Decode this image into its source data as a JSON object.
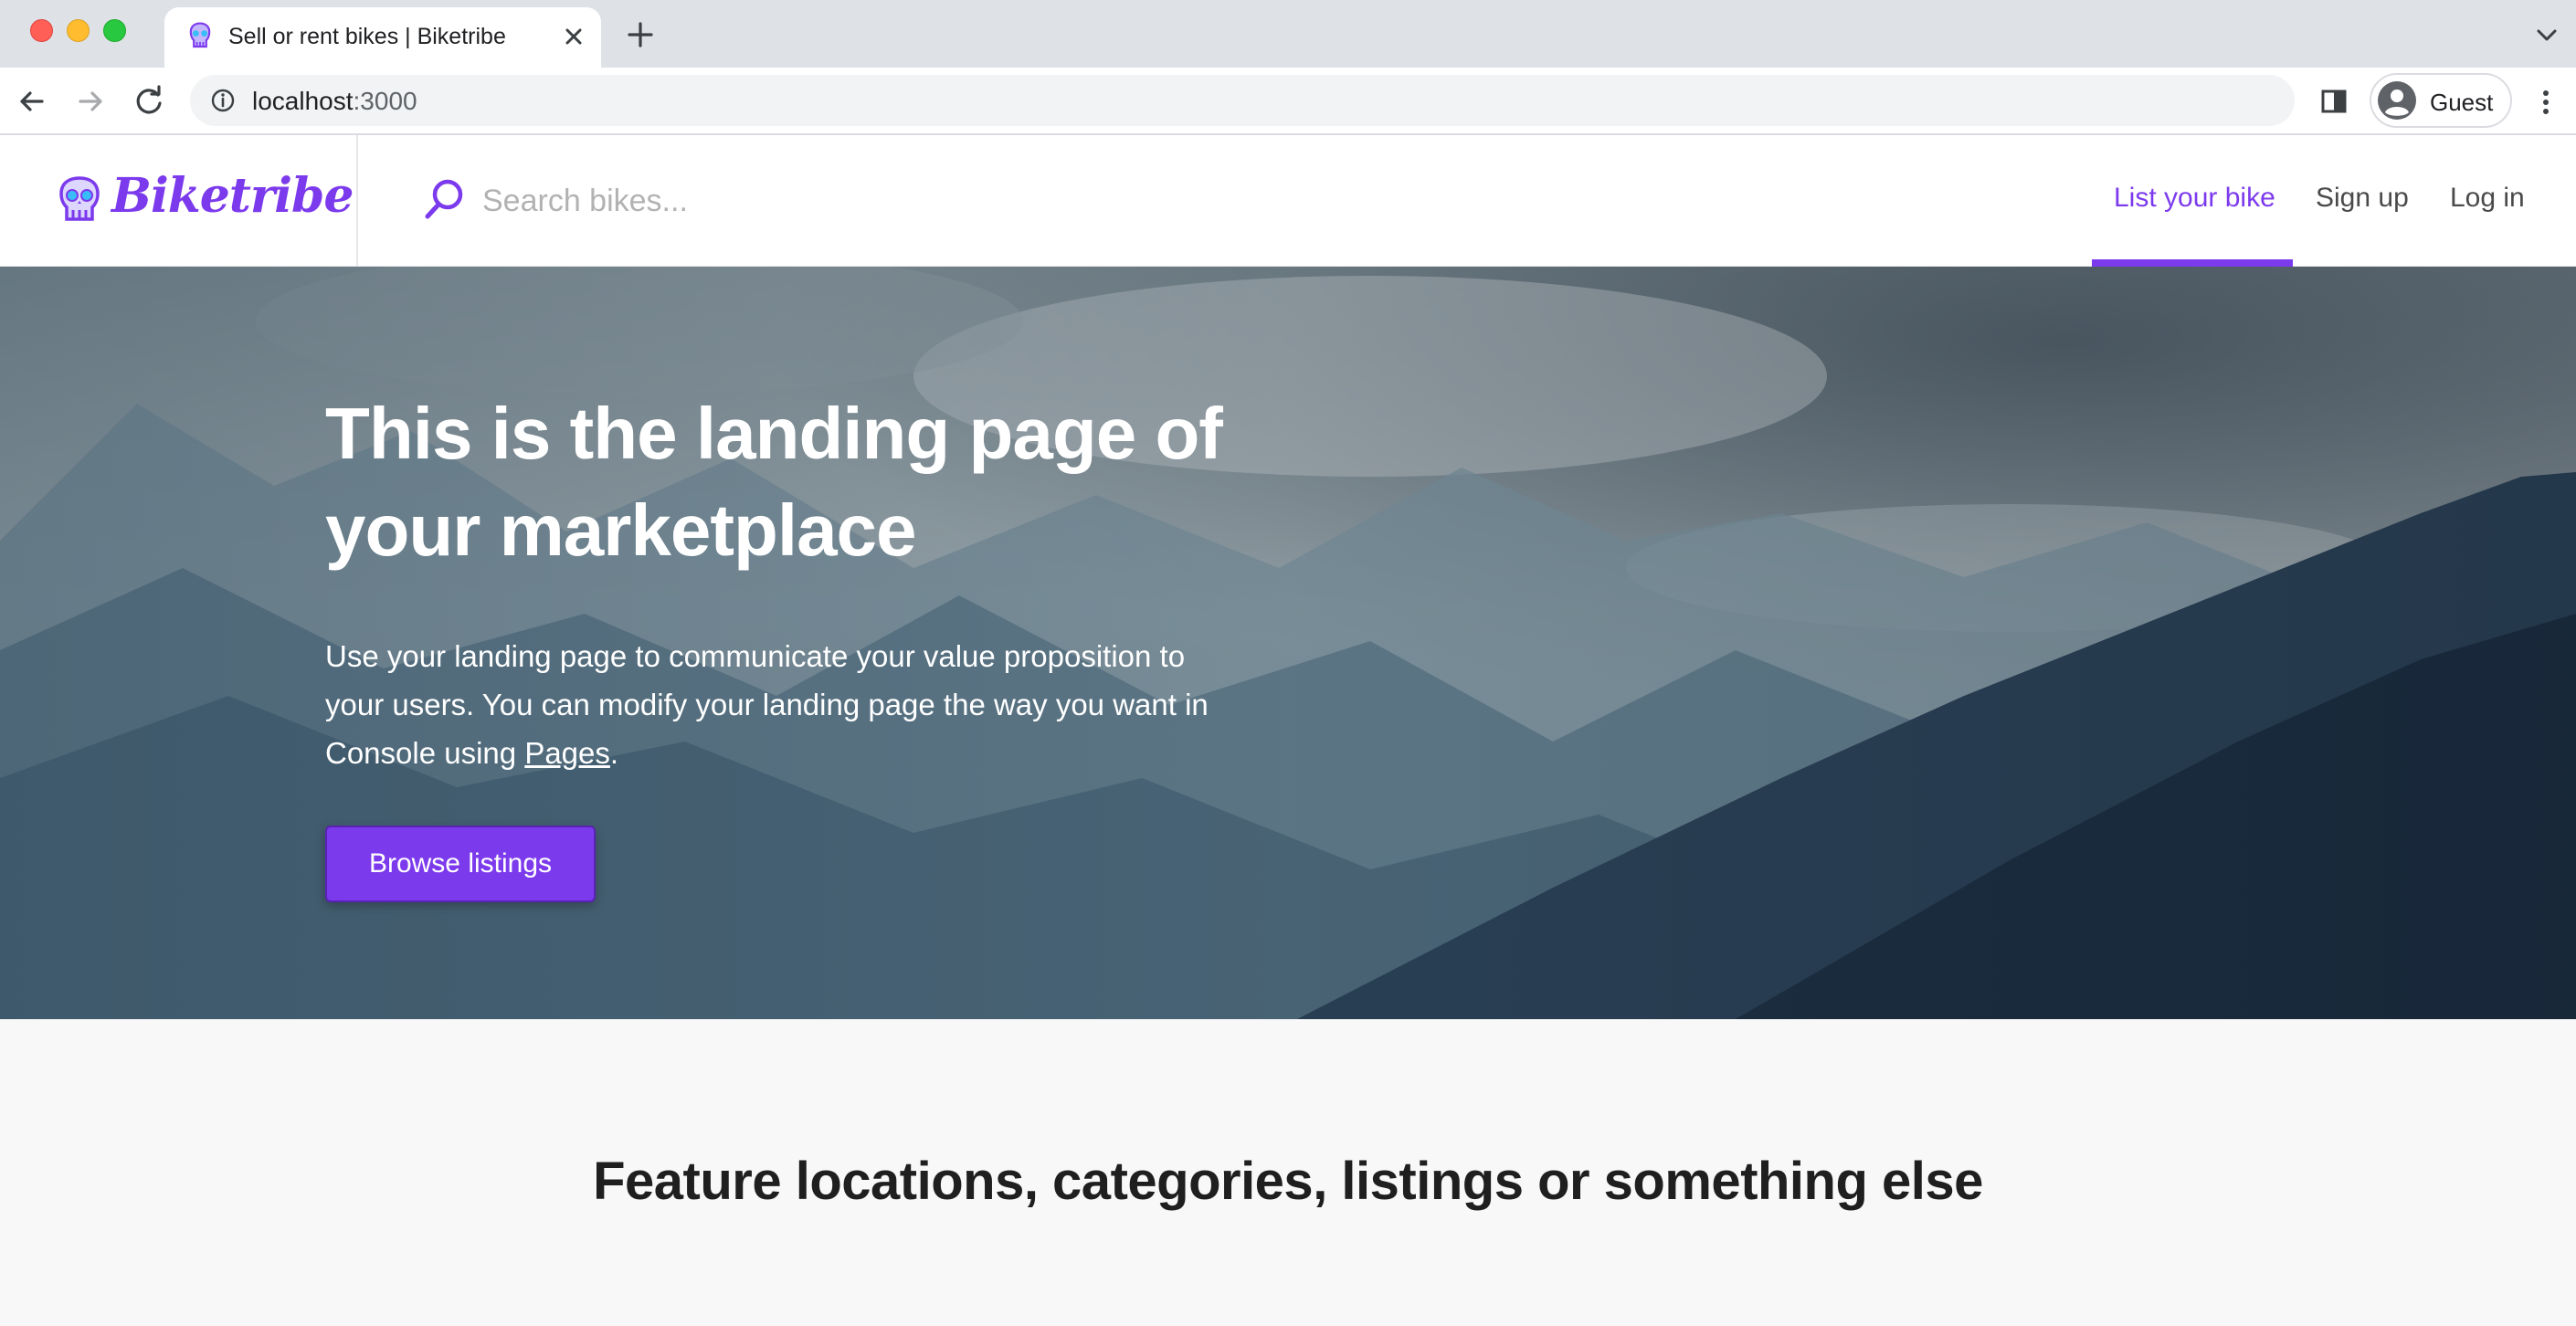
{
  "browser": {
    "tab_title": "Sell or rent bikes | Biketribe",
    "url_host": "localhost",
    "url_port": ":3000",
    "profile_name": "Guest"
  },
  "header": {
    "logo_text": "Biketribe",
    "search_placeholder": "Search bikes...",
    "nav": {
      "list_bike": "List your bike",
      "sign_up": "Sign up",
      "log_in": "Log in"
    }
  },
  "hero": {
    "title": "This is the landing page of your marketplace",
    "subtitle_before": "Use your landing page to communicate your value proposition to your users. You can modify your landing page the way you want in Console using ",
    "subtitle_link": "Pages",
    "subtitle_after": ".",
    "button_label": "Browse listings"
  },
  "section": {
    "title": "Feature locations, categories, listings or something else"
  },
  "colors": {
    "brand": "#7c3aed",
    "hero_overlay": "#2b4a5e"
  },
  "icons": [
    "skull-logo-icon",
    "search-icon",
    "close-icon",
    "plus-icon",
    "back-arrow-icon",
    "forward-arrow-icon",
    "reload-icon",
    "info-icon",
    "side-panel-icon",
    "avatar-icon",
    "more-vert-icon",
    "chevron-down-icon"
  ]
}
